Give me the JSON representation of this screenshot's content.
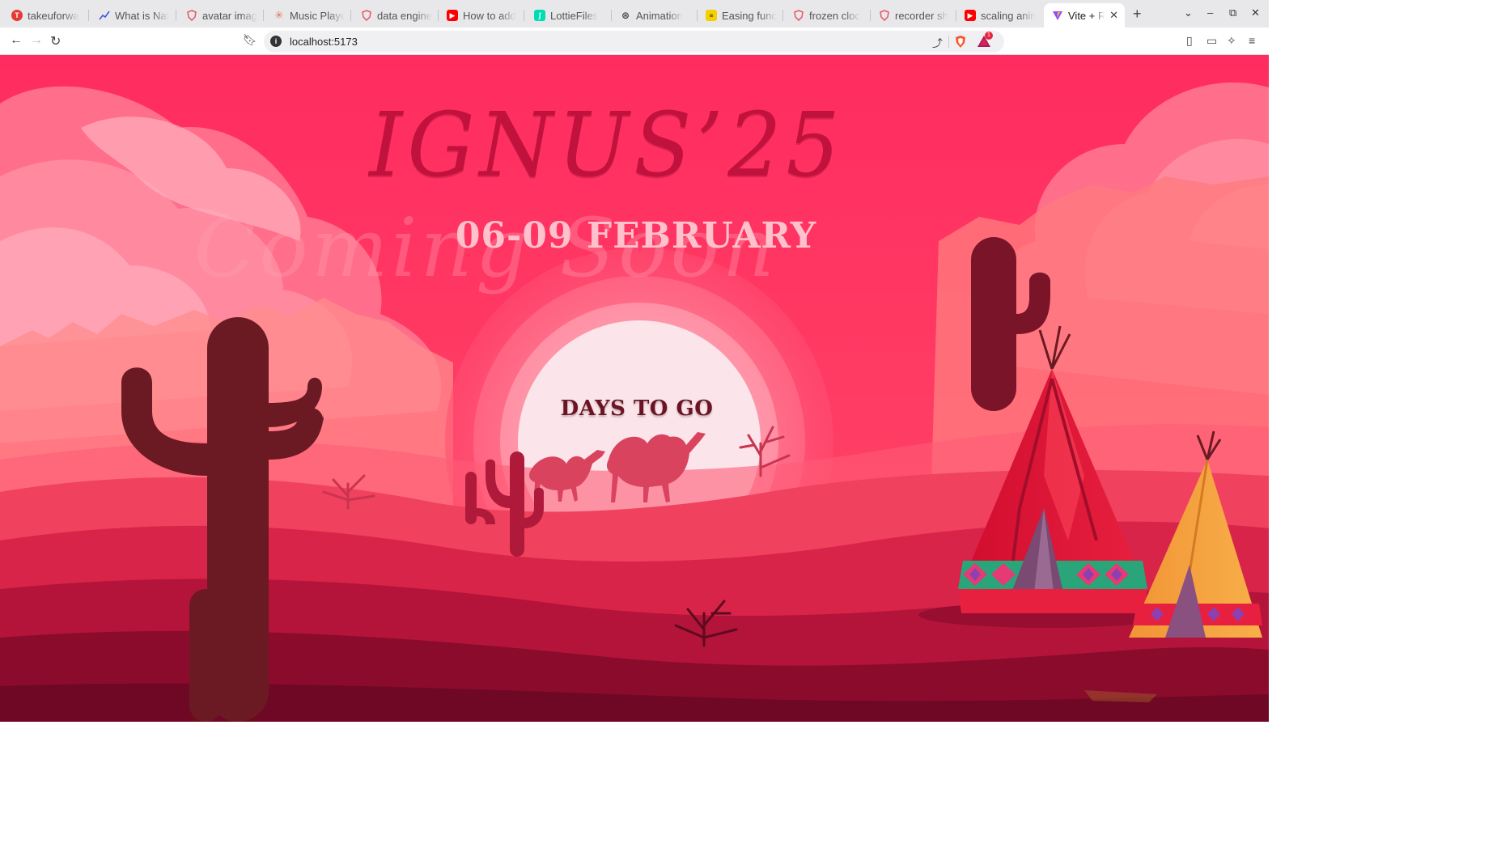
{
  "browser": {
    "tabs": [
      {
        "label": "takeuforwa",
        "icon": "tuf-icon",
        "color": "#e53935"
      },
      {
        "label": "What is Nat",
        "icon": "chart-icon",
        "color": "#3b5bdb"
      },
      {
        "label": "avatar imag",
        "icon": "brave-shield-icon",
        "color": "#e8546a"
      },
      {
        "label": "Music Playe",
        "icon": "claude-icon",
        "color": "#d97757"
      },
      {
        "label": "data engine",
        "icon": "brave-shield-icon",
        "color": "#e8546a"
      },
      {
        "label": "How to add",
        "icon": "youtube-icon",
        "color": "#ff0000"
      },
      {
        "label": "LottieFiles",
        "icon": "lottie-icon",
        "color": "#00ddb3"
      },
      {
        "label": "Animation",
        "icon": "openai-icon",
        "color": "#444444"
      },
      {
        "label": "Easing func",
        "icon": "easing-icon",
        "color": "#111111"
      },
      {
        "label": "frozen cloc",
        "icon": "brave-shield-icon",
        "color": "#e8546a"
      },
      {
        "label": "recorder sh",
        "icon": "brave-shield-icon",
        "color": "#e8546a"
      },
      {
        "label": "scaling anin",
        "icon": "youtube-icon",
        "color": "#ff0000"
      },
      {
        "label": "Vite + R",
        "icon": "vite-icon",
        "color": "#8a4dff",
        "active": true
      }
    ],
    "url": "localhost:5173",
    "rewards_badge": "1"
  },
  "page": {
    "title": "IGNUS’25",
    "dates": "06-09 FEBRUARY",
    "watermark": "Coming Soon",
    "countdown_label": "DAYS TO GO"
  },
  "colors": {
    "sky": "#ff2f5e",
    "sun": "#fbe4ea",
    "dune_dark": "#8a0b2c",
    "cactus": "#6b1a24"
  }
}
